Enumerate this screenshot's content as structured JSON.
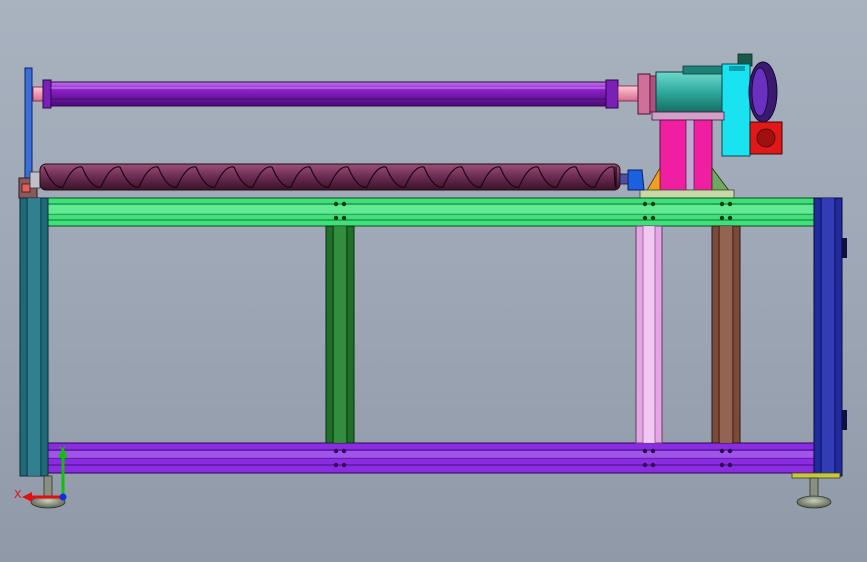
{
  "view": {
    "background_top": "#a9b2bf",
    "background_bottom": "#8f99a8"
  },
  "triad": {
    "x_label": "X",
    "y_label": "Y",
    "x_color": "#e01010",
    "y_color": "#10c010",
    "z_color": "#1030e0"
  },
  "colors": {
    "purple_roller": "#8a1fc4",
    "screw_roller": "#6b2b52",
    "green_rail": "#3ee07a",
    "purple_rail": "#8b2be2",
    "teal_post": "#1f6a78",
    "navy_post": "#202a9a",
    "dark_green_post": "#1f6e2a",
    "pink_post": "#e6a6e6",
    "brown_post": "#7a4a3a",
    "motor_teal": "#2aa89a",
    "magenta_support": "#f01ea0",
    "cyan_plate": "#19e3f0",
    "red_box": "#e01818"
  },
  "parts": [
    "upper-roller",
    "screw-roller",
    "gear-motor",
    "motor-support",
    "frame-top-rail",
    "frame-bottom-rail",
    "left-post",
    "right-post",
    "middle-post",
    "pink-post",
    "brown-post",
    "leveling-foot-left",
    "leveling-foot-right"
  ]
}
